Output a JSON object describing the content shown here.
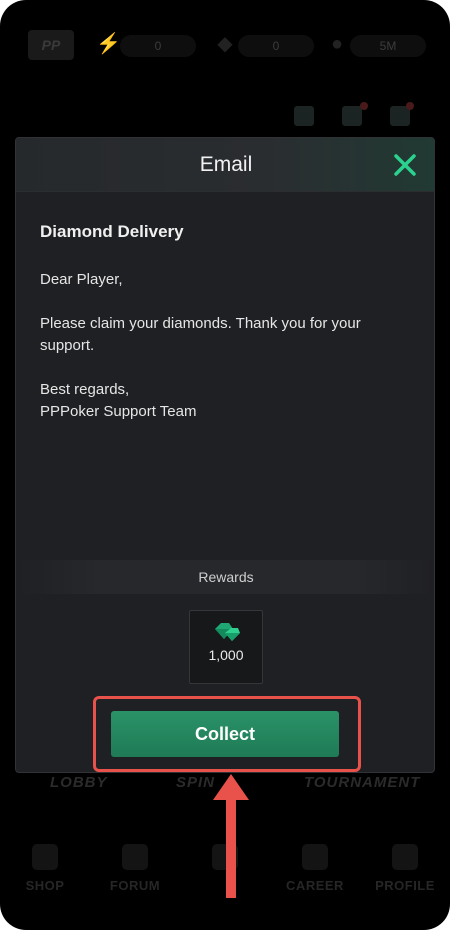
{
  "background": {
    "logo_text": "PP",
    "resources": [
      {
        "icon": "lightning-icon",
        "value": "0"
      },
      {
        "icon": "diamond-icon",
        "value": "0"
      },
      {
        "icon": "coin-icon",
        "value": "5M"
      }
    ],
    "modes": [
      "LOBBY",
      "SPIN",
      "TOURNAMENT"
    ],
    "tabs": [
      "SHOP",
      "FORUM",
      "",
      "CAREER",
      "PROFILE"
    ]
  },
  "modal": {
    "title": "Email",
    "subject": "Diamond Delivery",
    "body": "Dear Player,\n\nPlease claim your diamonds. Thank you for your support.\n\nBest regards,\nPPPoker Support Team",
    "rewards_label": "Rewards",
    "reward": {
      "icon": "emerald-diamond-icon",
      "amount": "1,000"
    },
    "collect_label": "Collect"
  },
  "colors": {
    "accent": "#1f7b55",
    "close": "#2bd28f",
    "annotation": "#e8524a"
  }
}
